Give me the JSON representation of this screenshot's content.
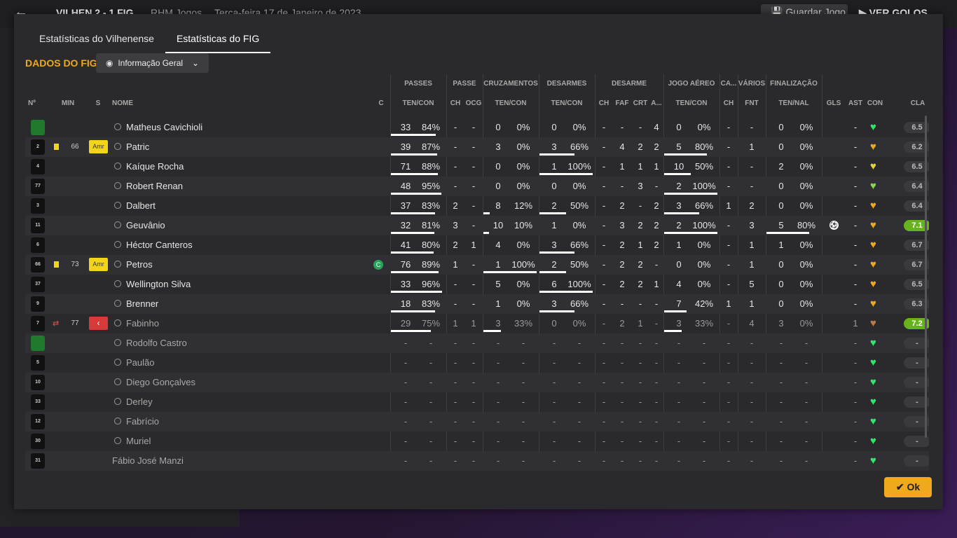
{
  "topbar": {
    "back_icon": "arrow-left-icon",
    "score": "VILHEN   2 - 1   FIG",
    "venue": "RHM Jogos",
    "date": "Terça-feira 17 de Janeiro de 2023",
    "save_label": "Guardar Jogo",
    "goals_label": "VER GOLOS"
  },
  "tabs": [
    {
      "label": "Estatísticas do Vilhenense"
    },
    {
      "label": "Estatísticas do FIG",
      "active": true
    }
  ],
  "section_title": "DADOS DO FIG",
  "dropdown": {
    "label": "Informação Geral",
    "icon": "eye-icon"
  },
  "group_headers": {
    "passes": "PASSES",
    "passe": "PASSE",
    "cruzamentos": "CRUZAMENTOS",
    "desarmes": "DESARMES",
    "desarme": "DESARME",
    "jogo_aereo": "JOGO AÉREO",
    "ca": "CA...",
    "varios": "VÁRIOS",
    "finalizacao": "FINALIZAÇÃO"
  },
  "col_headers": {
    "num": "Nº",
    "min": "MIN",
    "s": "S",
    "nome": "NOME",
    "c": "C",
    "pass_ten": "TEN/CON",
    "pass_ch": "CH",
    "pass_ocg": "OCG",
    "cruz": "TEN/CON",
    "desarmes": "TEN/CON",
    "d_ch": "CH",
    "d_faf": "FAF",
    "d_crt": "CRT",
    "d_a": "A...",
    "aereo": "TEN/CON",
    "ca_ch": "CH",
    "fnt": "FNT",
    "fin": "TEN/NAL",
    "gls": "GLS",
    "ast": "AST",
    "con": "CON",
    "cla": "CLA"
  },
  "rows": [
    {
      "num": "",
      "gk": true,
      "name": "Matheus Cavichioli",
      "pt": "33",
      "pp": "84%",
      "ch": "-",
      "ocg": "-",
      "ct": "0",
      "cp": "0%",
      "dt": "0",
      "dp": "0%",
      "dch": "-",
      "faf": "-",
      "crt": "-",
      "da": "4",
      "at": "0",
      "ap": "0%",
      "cach": "-",
      "fnt": "-",
      "ft": "0",
      "fp": "0%",
      "gls": "",
      "ast": "-",
      "heart": "#2ee86a",
      "cla": "6.5"
    },
    {
      "num": "2",
      "yc": true,
      "min": "66",
      "badge": "Amr",
      "name": "Patric",
      "pt": "39",
      "pp": "87%",
      "ch": "-",
      "ocg": "-",
      "ct": "3",
      "cp": "0%",
      "dt": "3",
      "dp": "66%",
      "dch": "-",
      "faf": "4",
      "crt": "2",
      "da": "2",
      "at": "5",
      "ap": "80%",
      "cach": "-",
      "fnt": "1",
      "ft": "0",
      "fp": "0%",
      "gls": "",
      "ast": "-",
      "heart": "#f0a81c",
      "cla": "6.2"
    },
    {
      "num": "4",
      "name": "Kaíque Rocha",
      "pt": "71",
      "pp": "88%",
      "ch": "-",
      "ocg": "-",
      "ct": "0",
      "cp": "0%",
      "dt": "1",
      "dp": "100%",
      "dch": "-",
      "faf": "1",
      "crt": "1",
      "da": "1",
      "at": "10",
      "ap": "50%",
      "cach": "-",
      "fnt": "-",
      "ft": "2",
      "fp": "0%",
      "gls": "",
      "ast": "-",
      "heart": "#e8d23a",
      "cla": "6.5"
    },
    {
      "num": "77",
      "name": "Robert Renan",
      "pt": "48",
      "pp": "95%",
      "ch": "-",
      "ocg": "-",
      "ct": "0",
      "cp": "0%",
      "dt": "0",
      "dp": "0%",
      "dch": "-",
      "faf": "-",
      "crt": "3",
      "da": "-",
      "at": "2",
      "ap": "100%",
      "cach": "-",
      "fnt": "-",
      "ft": "0",
      "fp": "0%",
      "gls": "",
      "ast": "-",
      "heart": "#8ad64a",
      "cla": "6.4"
    },
    {
      "num": "3",
      "name": "Dalbert",
      "pt": "37",
      "pp": "83%",
      "ch": "2",
      "ocg": "-",
      "ct": "8",
      "cp": "12%",
      "dt": "2",
      "dp": "50%",
      "dch": "-",
      "faf": "2",
      "crt": "-",
      "da": "2",
      "at": "3",
      "ap": "66%",
      "cach": "1",
      "fnt": "2",
      "ft": "0",
      "fp": "0%",
      "gls": "",
      "ast": "-",
      "heart": "#f0a81c",
      "cla": "6.4"
    },
    {
      "num": "11",
      "name": "Geuvânio",
      "pt": "32",
      "pp": "81%",
      "ch": "3",
      "ocg": "-",
      "ct": "10",
      "cp": "10%",
      "dt": "1",
      "dp": "0%",
      "dch": "-",
      "faf": "3",
      "crt": "2",
      "da": "2",
      "at": "2",
      "ap": "100%",
      "cach": "-",
      "fnt": "3",
      "ft": "5",
      "fp": "80%",
      "gls": "ball",
      "ast": "-",
      "heart": "#f0a81c",
      "cla": "7.1",
      "good": true
    },
    {
      "num": "6",
      "name": "Héctor Canteros",
      "pt": "41",
      "pp": "80%",
      "ch": "2",
      "ocg": "1",
      "ct": "4",
      "cp": "0%",
      "dt": "3",
      "dp": "66%",
      "dch": "-",
      "faf": "2",
      "crt": "1",
      "da": "2",
      "at": "1",
      "ap": "0%",
      "cach": "-",
      "fnt": "1",
      "ft": "1",
      "fp": "0%",
      "gls": "",
      "ast": "-",
      "heart": "#f0a81c",
      "cla": "6.7"
    },
    {
      "num": "66",
      "yc": true,
      "min": "73",
      "badge": "Amr",
      "captain": true,
      "name": "Petros",
      "pt": "76",
      "pp": "89%",
      "ch": "1",
      "ocg": "-",
      "ct": "1",
      "cp": "100%",
      "dt": "2",
      "dp": "50%",
      "dch": "-",
      "faf": "2",
      "crt": "2",
      "da": "-",
      "at": "0",
      "ap": "0%",
      "cach": "-",
      "fnt": "1",
      "ft": "0",
      "fp": "0%",
      "gls": "",
      "ast": "-",
      "heart": "#f0a81c",
      "cla": "6.7"
    },
    {
      "num": "37",
      "name": "Wellington Silva",
      "pt": "33",
      "pp": "96%",
      "ch": "-",
      "ocg": "-",
      "ct": "5",
      "cp": "0%",
      "dt": "6",
      "dp": "100%",
      "dch": "-",
      "faf": "2",
      "crt": "2",
      "da": "1",
      "at": "4",
      "ap": "0%",
      "cach": "-",
      "fnt": "5",
      "ft": "0",
      "fp": "0%",
      "gls": "",
      "ast": "-",
      "heart": "#f0a81c",
      "cla": "6.5"
    },
    {
      "num": "9",
      "name": "Brenner",
      "pt": "18",
      "pp": "83%",
      "ch": "-",
      "ocg": "-",
      "ct": "1",
      "cp": "0%",
      "dt": "3",
      "dp": "66%",
      "dch": "-",
      "faf": "-",
      "crt": "-",
      "da": "-",
      "at": "7",
      "ap": "42%",
      "cach": "1",
      "fnt": "1",
      "ft": "0",
      "fp": "0%",
      "gls": "",
      "ast": "-",
      "heart": "#f0a81c",
      "cla": "6.3"
    },
    {
      "num": "7",
      "sub": true,
      "min": "77",
      "redbadge": true,
      "dim": true,
      "name": "Fabinho",
      "pt": "29",
      "pp": "75%",
      "ch": "1",
      "ocg": "1",
      "ct": "3",
      "cp": "33%",
      "dt": "0",
      "dp": "0%",
      "dch": "-",
      "faf": "2",
      "crt": "1",
      "da": "-",
      "at": "3",
      "ap": "33%",
      "cach": "-",
      "fnt": "4",
      "ft": "3",
      "fp": "0%",
      "gls": "",
      "ast": "1",
      "heart": "#c07a40",
      "cla": "7.2",
      "good": true
    },
    {
      "num": "",
      "gk": true,
      "dim": true,
      "name": "Rodolfo Castro",
      "empty": true,
      "heart": "#2ee86a",
      "cla": "-"
    },
    {
      "num": "5",
      "dim": true,
      "name": "Paulão",
      "empty": true,
      "heart": "#2ee86a",
      "cla": "-"
    },
    {
      "num": "10",
      "dim": true,
      "name": "Diego Gonçalves",
      "empty": true,
      "heart": "#2ee86a",
      "cla": "-"
    },
    {
      "num": "33",
      "dim": true,
      "name": "Derley",
      "empty": true,
      "heart": "#2ee86a",
      "cla": "-"
    },
    {
      "num": "12",
      "dim": true,
      "name": "Fabrício",
      "empty": true,
      "heart": "#2ee86a",
      "cla": "-"
    },
    {
      "num": "30",
      "dim": true,
      "name": "Muriel",
      "empty": true,
      "heart": "#2ee86a",
      "cla": "-"
    },
    {
      "num": "31",
      "dim": true,
      "noicon": true,
      "name": "Fábio José Manzi",
      "empty": true,
      "heart": "#2ee86a",
      "cla": "-"
    }
  ],
  "ok_label": "Ok"
}
